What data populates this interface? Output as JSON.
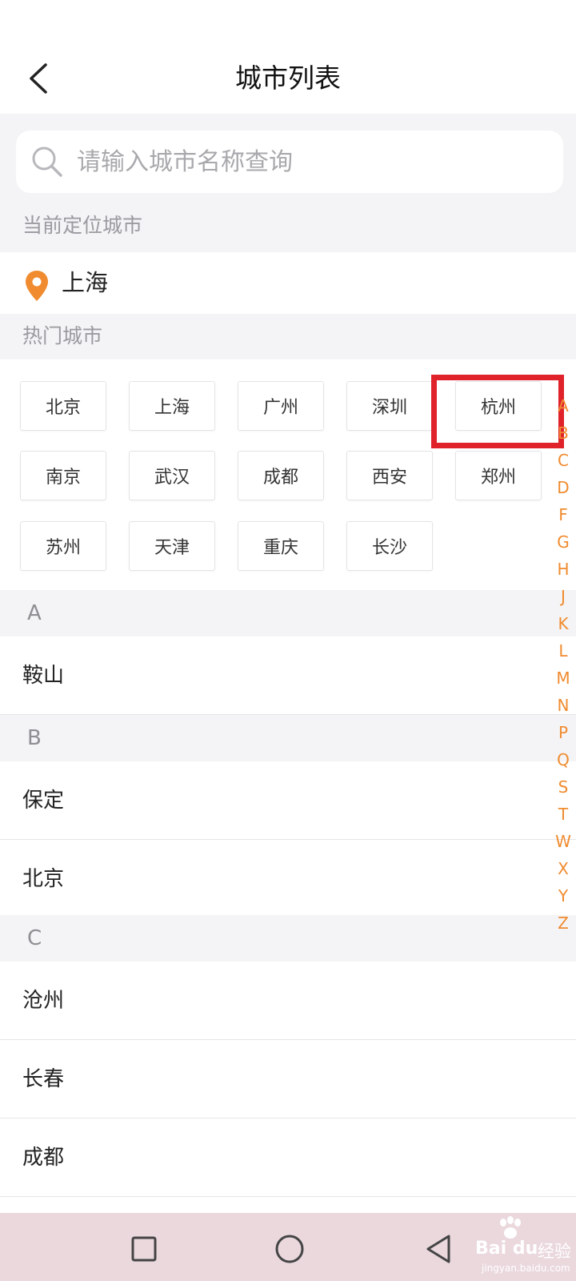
{
  "header": {
    "title": "城市列表"
  },
  "search": {
    "placeholder": "请输入城市名称查询"
  },
  "current": {
    "label": "当前定位城市",
    "city": "上海"
  },
  "hot": {
    "label": "热门城市",
    "cities": [
      "北京",
      "上海",
      "广州",
      "深圳",
      "杭州",
      "南京",
      "武汉",
      "成都",
      "西安",
      "郑州",
      "苏州",
      "天津",
      "重庆",
      "长沙"
    ],
    "highlighted": "杭州",
    "highlight_color": "#e0232b"
  },
  "list": {
    "groups": [
      {
        "letter": "A",
        "cities": [
          "鞍山"
        ]
      },
      {
        "letter": "B",
        "cities": [
          "保定",
          "北京"
        ]
      },
      {
        "letter": "C",
        "cities": [
          "沧州",
          "长春",
          "成都"
        ]
      }
    ]
  },
  "index": {
    "letters": [
      "A",
      "B",
      "C",
      "D",
      "F",
      "G",
      "H",
      "J",
      "K",
      "L",
      "M",
      "N",
      "P",
      "Q",
      "S",
      "T",
      "W",
      "X",
      "Y",
      "Z"
    ]
  },
  "navbar": {
    "icons": [
      "square-icon",
      "circle-icon",
      "back-triangle-icon"
    ]
  },
  "watermark": {
    "brand": "Bai du",
    "tag": "经验",
    "url": "jingyan.baidu.com"
  },
  "colors": {
    "accent": "#f08b2f",
    "background_gray": "#f4f4f6"
  }
}
